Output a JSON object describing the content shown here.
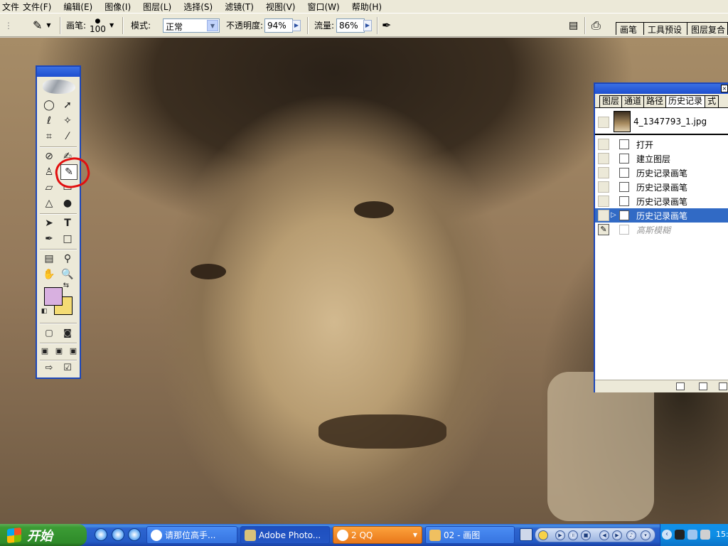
{
  "menu": [
    "文件",
    "文件(F)",
    "编辑(E)",
    "图像(I)",
    "图层(L)",
    "选择(S)",
    "滤镜(T)",
    "视图(V)",
    "窗口(W)",
    "帮助(H)"
  ],
  "options": {
    "brush_label": "画笔:",
    "brush_size": "100",
    "mode_label": "模式:",
    "mode_value": "正常",
    "opacity_label": "不透明度:",
    "opacity_value": "94%",
    "flow_label": "流量:",
    "flow_value": "86%"
  },
  "palette_well_tabs": [
    "画笔",
    "工具预设",
    "图层复合"
  ],
  "colors": {
    "foreground": "#d8b0e0",
    "background": "#f4dc74",
    "titlebar": "#1c47ba",
    "selection": "#316ac5",
    "annotation": "#e20f0f"
  },
  "toolbox": {
    "tools": [
      "marquee-tool",
      "move-tool",
      "lasso-tool",
      "magic-wand-tool",
      "crop-tool",
      "slice-tool",
      "healing-brush-tool",
      "brush-tool",
      "clone-stamp-tool",
      "history-brush-tool",
      "eraser-tool",
      "gradient-tool",
      "blur-tool",
      "dodge-tool",
      "path-selection-tool",
      "type-tool",
      "pen-tool",
      "shape-tool",
      "notes-tool",
      "eyedropper-tool",
      "hand-tool",
      "zoom-tool"
    ],
    "selected": "history-brush-tool"
  },
  "history": {
    "tabs": [
      "图层",
      "通道",
      "路径",
      "历史记录",
      "式"
    ],
    "active_tab": "历史记录",
    "snapshot": "4_1347793_1.jpg",
    "states": [
      {
        "label": "打开"
      },
      {
        "label": "建立图层"
      },
      {
        "label": "历史记录画笔"
      },
      {
        "label": "历史记录画笔"
      },
      {
        "label": "历史记录画笔"
      },
      {
        "label": "历史记录画笔"
      },
      {
        "label": "高斯模糊"
      }
    ],
    "selected_index": 5,
    "dimmed_index": 6
  },
  "taskbar": {
    "start_label": "开始",
    "tasks": [
      {
        "label": "请那位高手..."
      },
      {
        "label": "Adobe Photo..."
      },
      {
        "label": "2 QQ"
      },
      {
        "label": "02 - 画图"
      }
    ],
    "clock": "15:"
  }
}
